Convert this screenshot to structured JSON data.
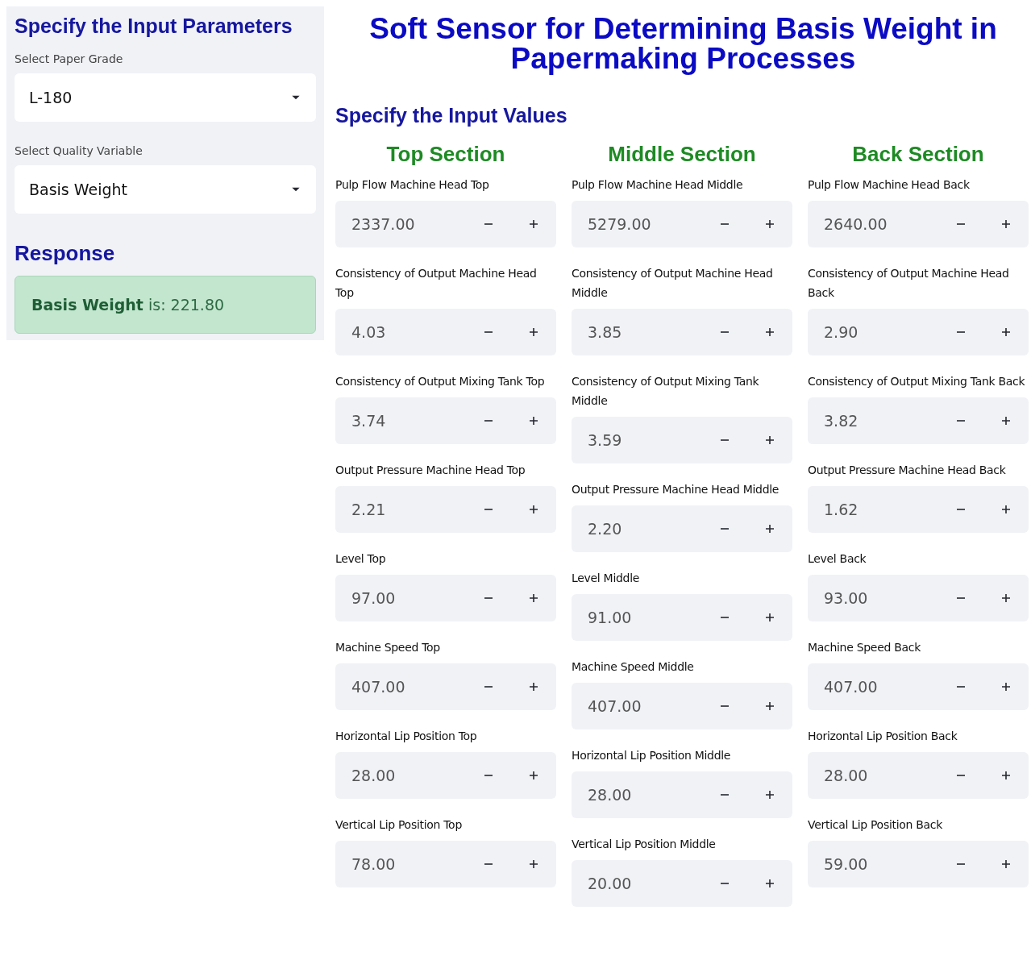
{
  "sidebar": {
    "title": "Specify the Input Parameters",
    "selects": [
      {
        "label": "Select Paper Grade",
        "value": "L-180"
      },
      {
        "label": "Select Quality Variable",
        "value": "Basis Weight"
      }
    ],
    "response": {
      "title": "Response",
      "message": "**Basis Weight** is: 221.80"
    }
  },
  "main": {
    "title": "Soft Sensor for Determining Basis Weight in Papermaking Processes",
    "subtitle": "Specify the Input Values",
    "sections": [
      {
        "title": "Top Section",
        "fields": [
          {
            "label": "Pulp Flow Machine Head Top",
            "value": "2337.00"
          },
          {
            "label": "Consistency of Output Machine Head Top",
            "value": "4.03"
          },
          {
            "label": "Consistency of Output Mixing Tank Top",
            "value": "3.74"
          },
          {
            "label": "Output Pressure Machine Head Top",
            "value": "2.21"
          },
          {
            "label": "Level Top",
            "value": "97.00"
          },
          {
            "label": "Machine Speed Top",
            "value": "407.00"
          },
          {
            "label": "Horizontal Lip Position Top",
            "value": "28.00"
          },
          {
            "label": "Vertical Lip Position Top",
            "value": "78.00"
          }
        ]
      },
      {
        "title": "Middle Section",
        "fields": [
          {
            "label": "Pulp Flow Machine Head Middle",
            "value": "5279.00"
          },
          {
            "label": "Consistency of Output Machine Head Middle",
            "value": "3.85"
          },
          {
            "label": "Consistency of Output Mixing Tank Middle",
            "value": "3.59"
          },
          {
            "label": "Output Pressure Machine Head Middle",
            "value": "2.20"
          },
          {
            "label": "Level Middle",
            "value": "91.00"
          },
          {
            "label": "Machine Speed Middle",
            "value": "407.00"
          },
          {
            "label": "Horizontal Lip Position Middle",
            "value": "28.00"
          },
          {
            "label": "Vertical Lip Position Middle",
            "value": "20.00"
          }
        ]
      },
      {
        "title": "Back Section",
        "fields": [
          {
            "label": "Pulp Flow Machine Head Back",
            "value": "2640.00"
          },
          {
            "label": "Consistency of Output Machine Head Back",
            "value": "2.90"
          },
          {
            "label": "Consistency of Output Mixing Tank Back",
            "value": "3.82"
          },
          {
            "label": "Output Pressure Machine Head Back",
            "value": "1.62"
          },
          {
            "label": "Level Back",
            "value": "93.00"
          },
          {
            "label": "Machine Speed Back",
            "value": "407.00"
          },
          {
            "label": "Horizontal Lip Position Back",
            "value": "28.00"
          },
          {
            "label": "Vertical Lip Position Back",
            "value": "59.00"
          }
        ]
      }
    ]
  }
}
